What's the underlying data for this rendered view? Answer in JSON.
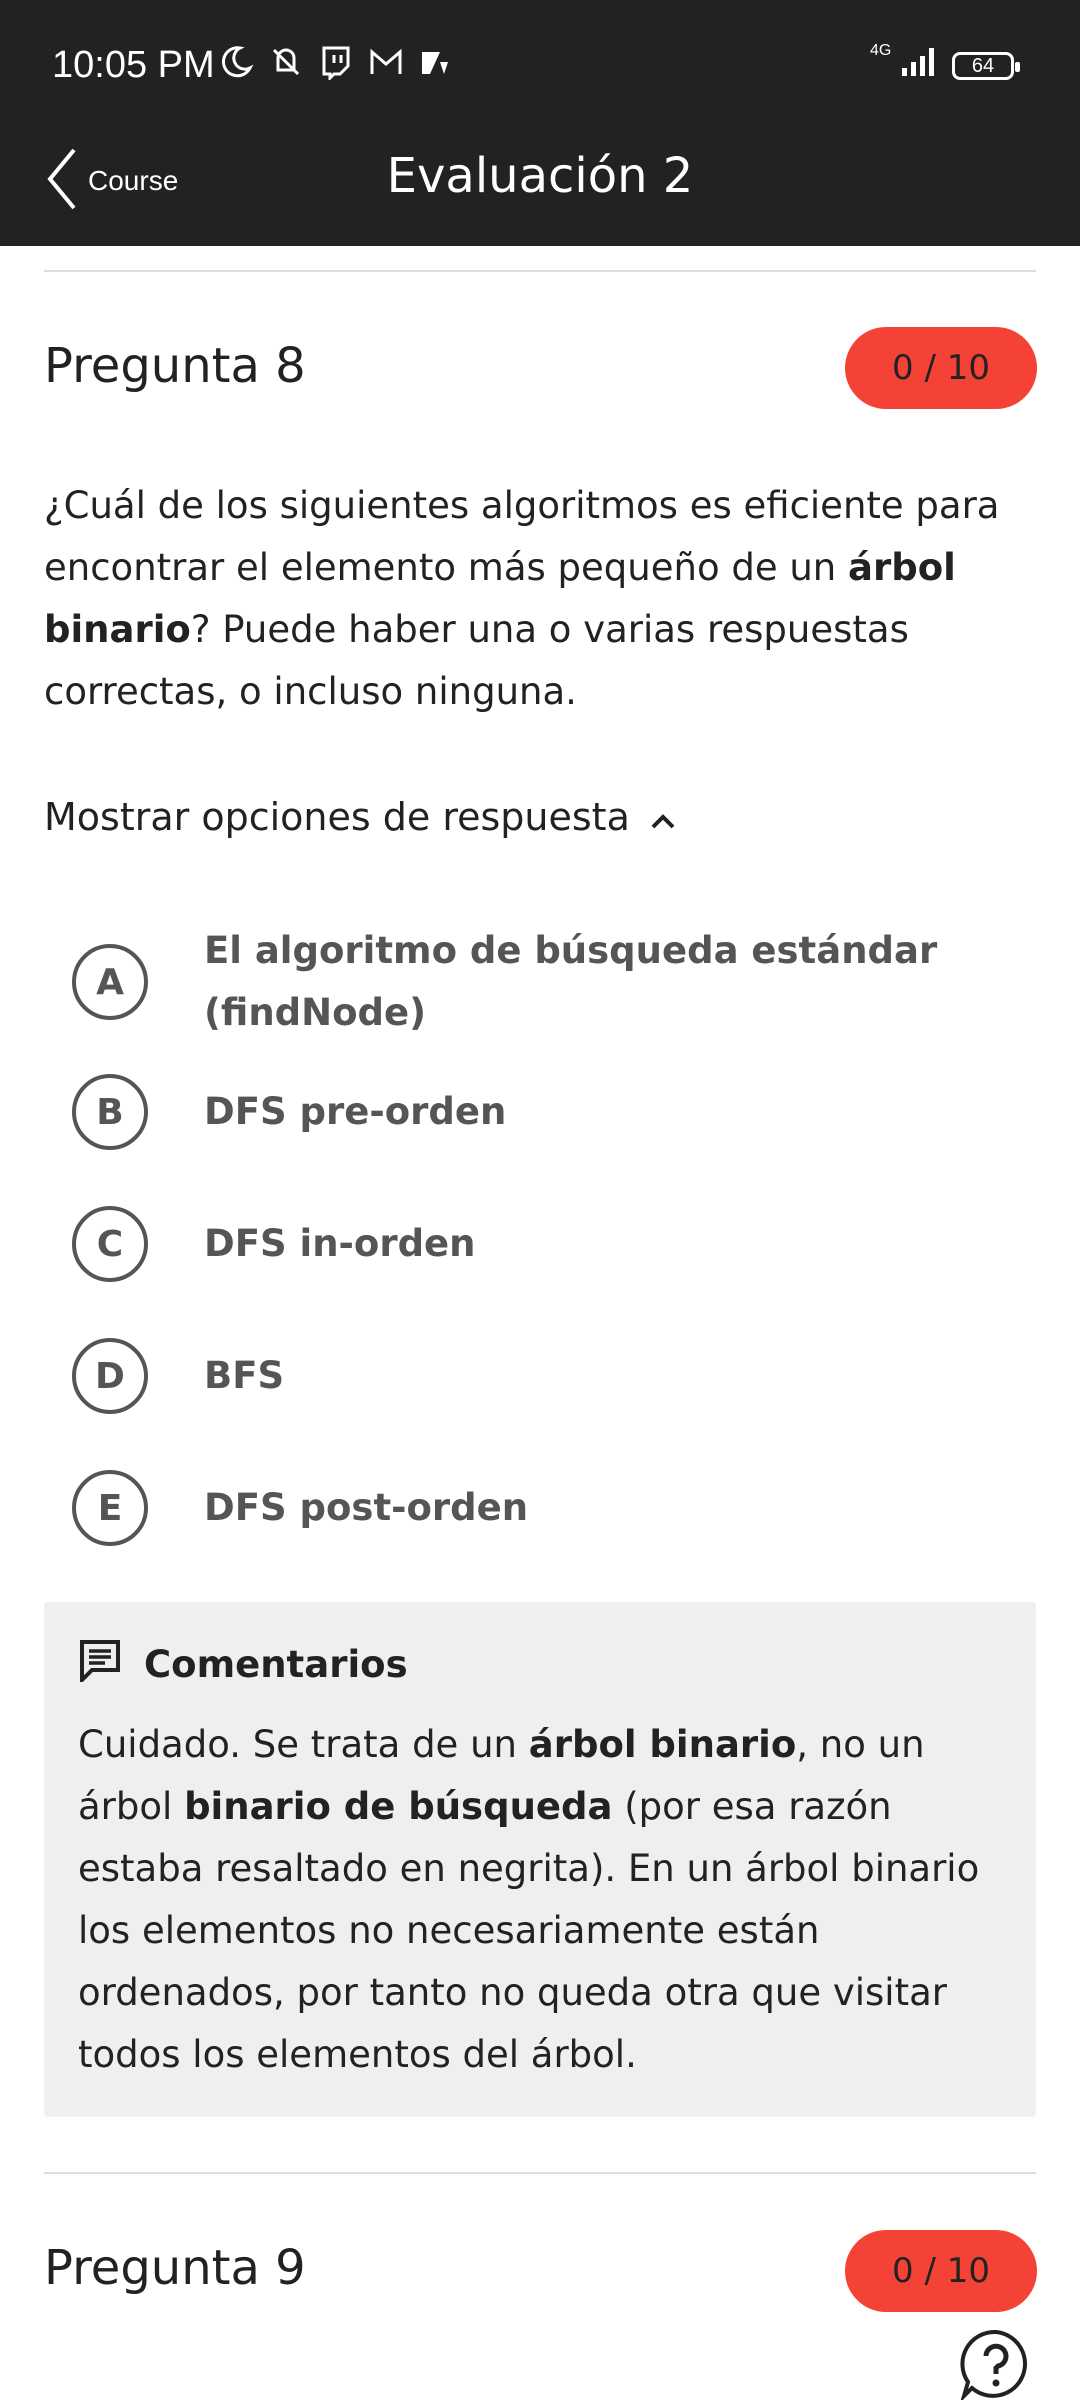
{
  "status_bar": {
    "time": "10:05 PM",
    "network": "4G",
    "battery": "64",
    "icons": [
      "moon-icon",
      "vibrate-off-icon",
      "twitch-icon",
      "gmail-icon",
      "app-icon",
      "signal-icon",
      "battery-icon"
    ]
  },
  "app_bar": {
    "back_label": "Course",
    "title": "Evaluación 2"
  },
  "questions": [
    {
      "title": "Pregunta 8",
      "score": "0 / 10",
      "text_parts": {
        "p1": "¿Cuál de los siguientes algoritmos es eficiente para encontrar el elemento más pequeño de un ",
        "b1": "árbol binario",
        "p2": "? Puede haber una o varias respuestas correctas, o incluso ninguna."
      },
      "toggle_label": "Mostrar opciones de respuesta",
      "options": [
        {
          "letter": "A",
          "text": "El algoritmo de búsqueda estándar (findNode)"
        },
        {
          "letter": "B",
          "text": "DFS pre-orden"
        },
        {
          "letter": "C",
          "text": "DFS in-orden"
        },
        {
          "letter": "D",
          "text": "BFS"
        },
        {
          "letter": "E",
          "text": "DFS post-orden"
        }
      ],
      "feedback": {
        "title": "Comentarios",
        "parts": {
          "p1": "Cuidado. Se trata de un ",
          "b1": "árbol binario",
          "p2": ", no un árbol ",
          "b2": "binario de búsqueda",
          "p3": " (por esa razón estaba resaltado en negrita). En un árbol binario los elementos no necesariamente están ordenados, por tanto no queda otra que visitar todos los elementos del árbol."
        }
      }
    },
    {
      "title": "Pregunta 9",
      "score": "0 / 10"
    }
  ],
  "colors": {
    "bar": "#222222",
    "score_badge": "#f44336",
    "feedback_bg": "#efefef",
    "option_gray": "#555555"
  }
}
